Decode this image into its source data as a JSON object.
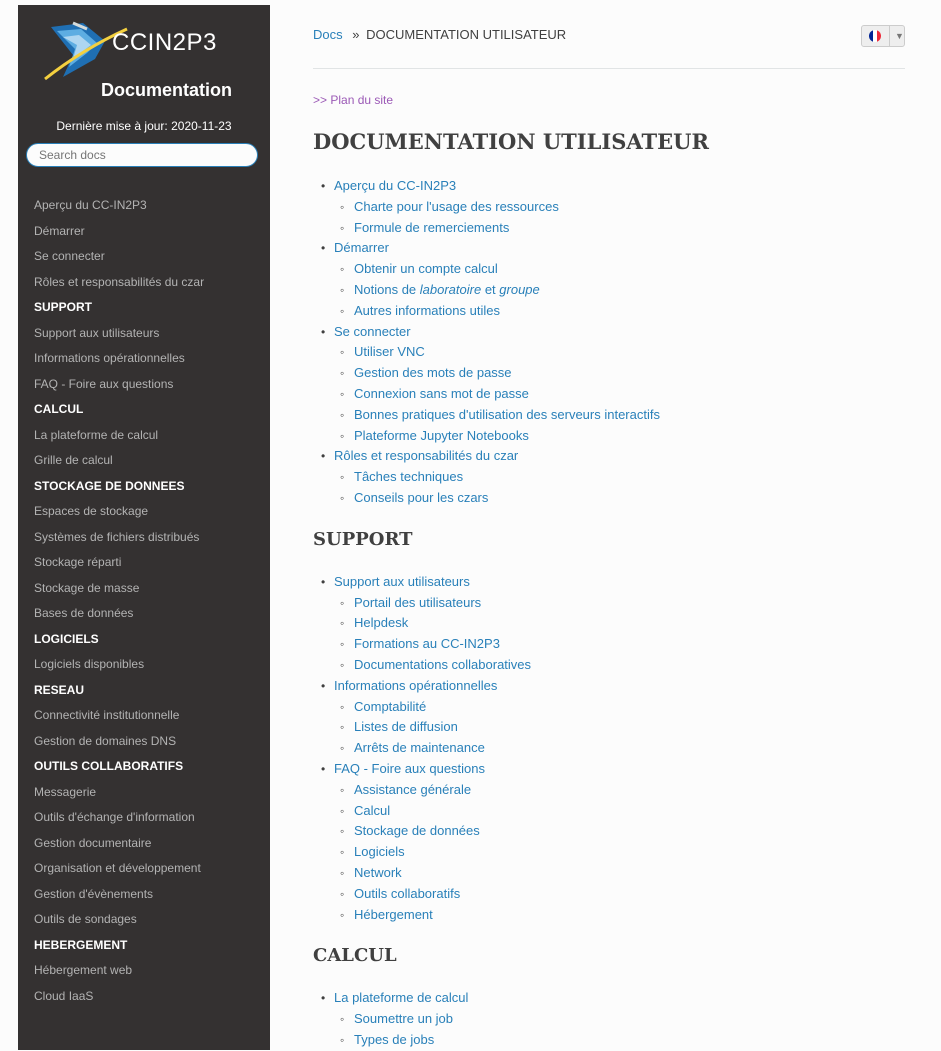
{
  "sidebar": {
    "brand": {
      "name": "CCIN2P3",
      "subtitle": "Documentation"
    },
    "last_update": "Dernière mise à jour: 2020-11-23",
    "search_placeholder": "Search docs",
    "nav": [
      {
        "type": "item",
        "label": "Aperçu du CC-IN2P3"
      },
      {
        "type": "item",
        "label": "Démarrer"
      },
      {
        "type": "item",
        "label": "Se connecter"
      },
      {
        "type": "item",
        "label": "Rôles et responsabilités du czar"
      },
      {
        "type": "caption",
        "label": "SUPPORT"
      },
      {
        "type": "item",
        "label": "Support aux utilisateurs"
      },
      {
        "type": "item",
        "label": "Informations opérationnelles"
      },
      {
        "type": "item",
        "label": "FAQ - Foire aux questions"
      },
      {
        "type": "caption",
        "label": "CALCUL"
      },
      {
        "type": "item",
        "label": "La plateforme de calcul"
      },
      {
        "type": "item",
        "label": "Grille de calcul"
      },
      {
        "type": "caption",
        "label": "STOCKAGE DE DONNEES"
      },
      {
        "type": "item",
        "label": "Espaces de stockage"
      },
      {
        "type": "item",
        "label": "Systèmes de fichiers distribués"
      },
      {
        "type": "item",
        "label": "Stockage réparti"
      },
      {
        "type": "item",
        "label": "Stockage de masse"
      },
      {
        "type": "item",
        "label": "Bases de données"
      },
      {
        "type": "caption",
        "label": "LOGICIELS"
      },
      {
        "type": "item",
        "label": "Logiciels disponibles"
      },
      {
        "type": "caption",
        "label": "RESEAU"
      },
      {
        "type": "item",
        "label": "Connectivité institutionnelle"
      },
      {
        "type": "item",
        "label": "Gestion de domaines DNS"
      },
      {
        "type": "caption",
        "label": "OUTILS COLLABORATIFS"
      },
      {
        "type": "item",
        "label": "Messagerie"
      },
      {
        "type": "item",
        "label": "Outils d'échange d'information"
      },
      {
        "type": "item",
        "label": "Gestion documentaire"
      },
      {
        "type": "item",
        "label": "Organisation et développement"
      },
      {
        "type": "item",
        "label": "Gestion d'évènements"
      },
      {
        "type": "item",
        "label": "Outils de sondages"
      },
      {
        "type": "caption",
        "label": "HEBERGEMENT"
      },
      {
        "type": "item",
        "label": "Hébergement web"
      },
      {
        "type": "item",
        "label": "Cloud IaaS"
      }
    ]
  },
  "breadcrumb": {
    "home": "Docs",
    "separator": "»",
    "current": "DOCUMENTATION UTILISATEUR"
  },
  "language": {
    "flag_colors": [
      "#002395",
      "#ffffff",
      "#ed2939"
    ]
  },
  "sitemap_link": ">> Plan du site",
  "page_title": "DOCUMENTATION UTILISATEUR",
  "toc_first": [
    {
      "label": "Aperçu du CC-IN2P3",
      "children": [
        {
          "label": "Charte pour l'usage des ressources"
        },
        {
          "label": "Formule de remerciements"
        }
      ]
    },
    {
      "label": "Démarrer",
      "children": [
        {
          "label": "Obtenir un compte calcul"
        },
        {
          "parts": [
            {
              "text": "Notions de "
            },
            {
              "text": "laboratoire",
              "em": true
            },
            {
              "text": " et "
            },
            {
              "text": "groupe",
              "em": true
            }
          ]
        },
        {
          "label": "Autres informations utiles"
        }
      ]
    },
    {
      "label": "Se connecter",
      "children": [
        {
          "label": "Utiliser VNC"
        },
        {
          "label": "Gestion des mots de passe"
        },
        {
          "label": "Connexion sans mot de passe"
        },
        {
          "label": "Bonnes pratiques d'utilisation des serveurs interactifs"
        },
        {
          "label": "Plateforme Jupyter Notebooks"
        }
      ]
    },
    {
      "label": "Rôles et responsabilités du czar",
      "children": [
        {
          "label": "Tâches techniques"
        },
        {
          "label": "Conseils pour les czars"
        }
      ]
    }
  ],
  "sections": [
    {
      "title": "SUPPORT",
      "items": [
        {
          "label": "Support aux utilisateurs",
          "children": [
            {
              "label": "Portail des utilisateurs"
            },
            {
              "label": "Helpdesk"
            },
            {
              "label": "Formations au CC-IN2P3"
            },
            {
              "label": "Documentations collaboratives"
            }
          ]
        },
        {
          "label": "Informations opérationnelles",
          "children": [
            {
              "label": "Comptabilité"
            },
            {
              "label": "Listes de diffusion"
            },
            {
              "label": "Arrêts de maintenance"
            }
          ]
        },
        {
          "label": "FAQ - Foire aux questions",
          "children": [
            {
              "label": "Assistance générale"
            },
            {
              "label": "Calcul"
            },
            {
              "label": "Stockage de données"
            },
            {
              "label": "Logiciels"
            },
            {
              "label": "Network"
            },
            {
              "label": "Outils collaboratifs"
            },
            {
              "label": "Hébergement"
            }
          ]
        }
      ]
    },
    {
      "title": "CALCUL",
      "items": [
        {
          "label": "La plateforme de calcul",
          "children": [
            {
              "label": "Soumettre un job"
            },
            {
              "label": "Types de jobs"
            }
          ]
        }
      ]
    }
  ]
}
